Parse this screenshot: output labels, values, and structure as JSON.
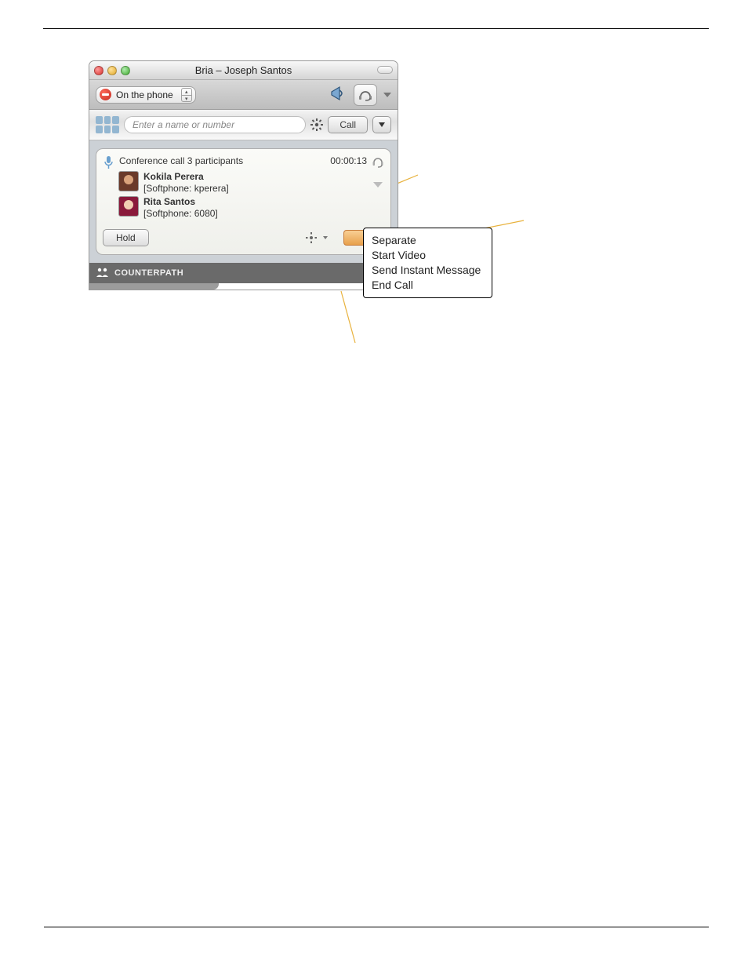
{
  "titlebar": {
    "title": "Bria – Joseph Santos"
  },
  "status": {
    "presence_label": "On the phone"
  },
  "dial": {
    "input_placeholder": "Enter a name or number",
    "call_label": "Call"
  },
  "call": {
    "header": "Conference call 3 participants",
    "timer": "00:00:13",
    "participants": [
      {
        "name": "Kokila Perera",
        "detail": "[Softphone: kperera]"
      },
      {
        "name": "Rita Santos",
        "detail": "[Softphone: 6080]"
      }
    ],
    "hold_label": "Hold"
  },
  "footer": {
    "brand": "COUNTERPATH"
  },
  "context_menu": {
    "items": [
      "Separate",
      "Start Video",
      "Send Instant Message",
      "End Call"
    ]
  }
}
